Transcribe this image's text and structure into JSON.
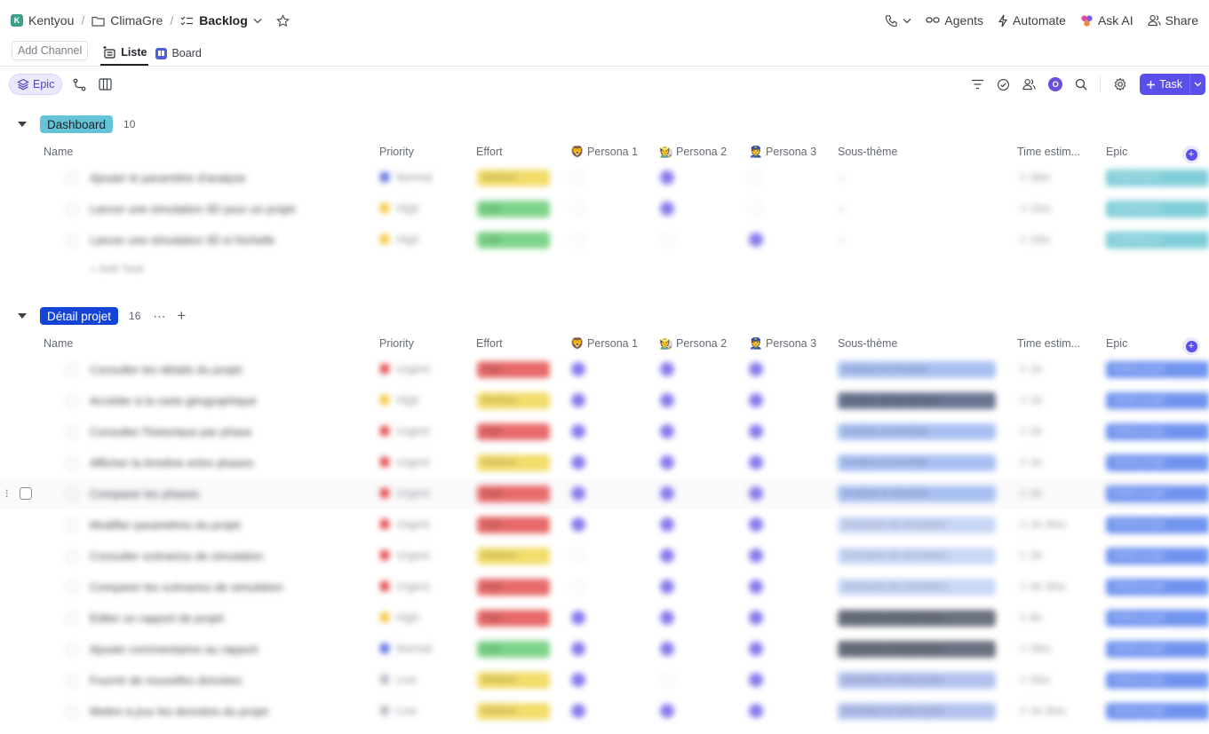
{
  "breadcrumb": {
    "workspace_initial": "K",
    "workspace": "Kentyou",
    "folder": "ClimaGre",
    "list": "Backlog"
  },
  "header_actions": {
    "agents": "Agents",
    "automate": "Automate",
    "ask_ai": "Ask AI",
    "share": "Share"
  },
  "views": {
    "add_channel": "Add Channel",
    "list_tab": "Liste",
    "board_tab": "Board"
  },
  "toolbar": {
    "group_chip": "Epic",
    "avatar_initial": "O",
    "task_button": "Task"
  },
  "columns": {
    "name": "Name",
    "priority": "Priority",
    "effort": "Effort",
    "persona1": "Persona 1",
    "persona2": "Persona 2",
    "persona3": "Persona 3",
    "sous_theme": "Sous-thème",
    "time_est": "Time estim...",
    "epic": "Epic"
  },
  "persona_emojis": {
    "p1": "🦁",
    "p2": "🧑‍🌾",
    "p3": "👮"
  },
  "colors": {
    "accent": "#5b4fe9",
    "dashboard_badge": "#64c3d6",
    "detail_badge": "#1443d8"
  },
  "groups": [
    {
      "label": "Dashboard",
      "count": "10",
      "badge_bg": "#64c3d6",
      "badge_fg": "#1f2328",
      "add_task_label": "Add Task",
      "rows": [
        {
          "name": "Ajouter le paramètre d'analyse",
          "priority": "Normal",
          "priority_color": "#5b6fe0",
          "effort": "Medium",
          "effort_color": "#f2dd6a",
          "p1": false,
          "p2": true,
          "p3": false,
          "sous_theme": "",
          "sous_theme_color": "",
          "time": "30m",
          "epic": "Dashboard",
          "epic_color": "#7fcdd8"
        },
        {
          "name": "Lancer une simulation 3D pour un projet",
          "priority": "High",
          "priority_color": "#f5c542",
          "effort": "Low",
          "effort_color": "#7cd489",
          "p1": false,
          "p2": true,
          "p3": false,
          "sous_theme": "",
          "sous_theme_color": "",
          "time": "15m",
          "epic": "Dashboard",
          "epic_color": "#7fcdd8"
        },
        {
          "name": "Lancer une simulation 3D à l'échelle",
          "priority": "High",
          "priority_color": "#f5c542",
          "effort": "Low",
          "effort_color": "#7cd489",
          "p1": false,
          "p2": false,
          "p3": true,
          "sous_theme": "",
          "sous_theme_color": "",
          "time": "15m",
          "epic": "Dashboard",
          "epic_color": "#7fcdd8"
        }
      ]
    },
    {
      "label": "Détail projet",
      "count": "16",
      "badge_bg": "#1443d8",
      "badge_fg": "#ffffff",
      "rows": [
        {
          "name": "Consulter les détails du projet",
          "priority": "Urgent",
          "priority_color": "#e5484d",
          "effort": "High",
          "effort_color": "#e86a6a",
          "p1": true,
          "p2": true,
          "p3": true,
          "sous_theme": "Analyse et résultats",
          "sous_theme_color": "#a9c0f2",
          "time": "1h",
          "epic": "Détail projet",
          "epic_color": "#6f93ef"
        },
        {
          "name": "Accéder à la carte géographique",
          "priority": "High",
          "priority_color": "#f5c542",
          "effort": "Medium",
          "effort_color": "#f2dd6a",
          "p1": true,
          "p2": true,
          "p3": true,
          "sous_theme": "Analyse géographique",
          "sous_theme_color": "#6b7592",
          "time": "1h",
          "epic": "Détail projet",
          "epic_color": "#6f93ef"
        },
        {
          "name": "Consulter l'historique par phase",
          "priority": "Urgent",
          "priority_color": "#e5484d",
          "effort": "High",
          "effort_color": "#e86a6a",
          "p1": true,
          "p2": true,
          "p3": true,
          "sous_theme": "Analyse et résultats",
          "sous_theme_color": "#a9c0f2",
          "time": "2h",
          "epic": "Détail projet",
          "epic_color": "#6f93ef"
        },
        {
          "name": "Afficher la timeline entre phases",
          "priority": "Urgent",
          "priority_color": "#e5484d",
          "effort": "Medium",
          "effort_color": "#f2dd6a",
          "p1": true,
          "p2": true,
          "p3": true,
          "sous_theme": "Analyse et résultats",
          "sous_theme_color": "#a9c0f2",
          "time": "1h",
          "epic": "Détail projet",
          "epic_color": "#6f93ef"
        },
        {
          "name": "Comparer les phases",
          "priority": "Urgent",
          "priority_color": "#e5484d",
          "effort": "High",
          "effort_color": "#e86a6a",
          "p1": true,
          "p2": true,
          "p3": true,
          "sous_theme": "Analyse et résultats",
          "sous_theme_color": "#a9c0f2",
          "time": "2h",
          "epic": "Détail projet",
          "epic_color": "#6f93ef"
        },
        {
          "name": "Modifier paramètres du projet",
          "priority": "Urgent",
          "priority_color": "#e5484d",
          "effort": "High",
          "effort_color": "#e86a6a",
          "p1": true,
          "p2": true,
          "p3": true,
          "sous_theme": "Scénarios de simulation",
          "sous_theme_color": "#c9d7f6",
          "time": "1h 30m",
          "epic": "Détail projet",
          "epic_color": "#6f93ef"
        },
        {
          "name": "Consulter scénarios de simulation",
          "priority": "Urgent",
          "priority_color": "#e5484d",
          "effort": "Medium",
          "effort_color": "#f2dd6a",
          "p1": false,
          "p2": true,
          "p3": true,
          "sous_theme": "Scénarios de simulation",
          "sous_theme_color": "#c9d7f6",
          "time": "2h",
          "epic": "Détail projet",
          "epic_color": "#6f93ef"
        },
        {
          "name": "Comparer les scénarios de simulation",
          "priority": "Urgent",
          "priority_color": "#e5484d",
          "effort": "High",
          "effort_color": "#e86a6a",
          "p1": false,
          "p2": true,
          "p3": true,
          "sous_theme": "Scénarios de simulation",
          "sous_theme_color": "#c9d7f6",
          "time": "4h 30m",
          "epic": "Détail projet",
          "epic_color": "#6f93ef"
        },
        {
          "name": "Éditer un rapport de projet",
          "priority": "High",
          "priority_color": "#f5c542",
          "effort": "High",
          "effort_color": "#e86a6a",
          "p1": true,
          "p2": true,
          "p3": true,
          "sous_theme": "Rapports et exportation",
          "sous_theme_color": "#6b7180",
          "time": "6h",
          "epic": "Détail projet",
          "epic_color": "#6f93ef"
        },
        {
          "name": "Ajouter commentaires au rapport",
          "priority": "Normal",
          "priority_color": "#5b6fe0",
          "effort": "Low",
          "effort_color": "#7cd489",
          "p1": true,
          "p2": true,
          "p3": true,
          "sous_theme": "Rapports et exportation",
          "sous_theme_color": "#6b7180",
          "time": "30m",
          "epic": "Détail projet",
          "epic_color": "#6f93ef"
        },
        {
          "name": "Fournir de nouvelles données",
          "priority": "Low",
          "priority_color": "#b9bec6",
          "effort": "Medium",
          "effort_color": "#f2dd6a",
          "p1": true,
          "p2": false,
          "p3": true,
          "sous_theme": "Données et mise à jour",
          "sous_theme_color": "#b4c2ef",
          "time": "45m",
          "epic": "Détail projet",
          "epic_color": "#6f93ef"
        },
        {
          "name": "Mettre à jour les données du projet",
          "priority": "Low",
          "priority_color": "#b9bec6",
          "effort": "Medium",
          "effort_color": "#f2dd6a",
          "p1": true,
          "p2": true,
          "p3": true,
          "sous_theme": "Données et mise à jour",
          "sous_theme_color": "#b4c2ef",
          "time": "1h 30m",
          "epic": "Détail projet",
          "epic_color": "#6f93ef"
        }
      ]
    }
  ]
}
